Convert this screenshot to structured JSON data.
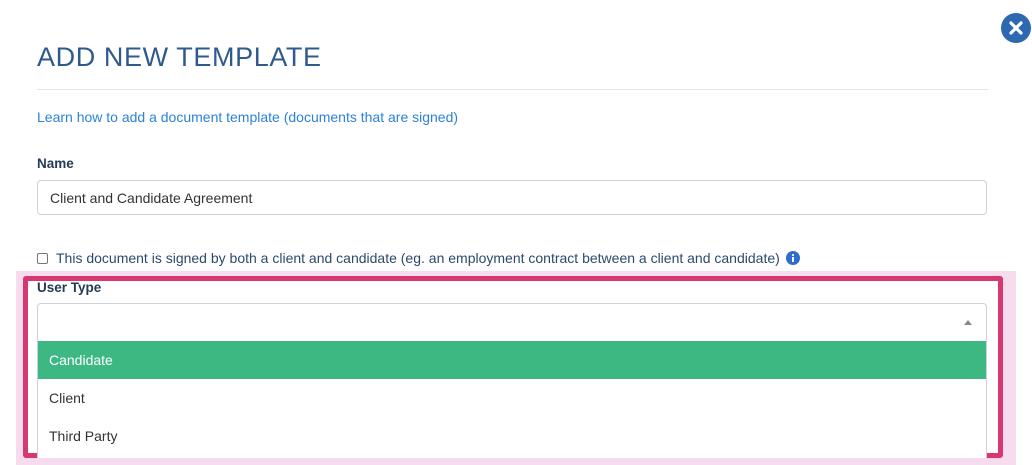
{
  "modal": {
    "title": "ADD NEW TEMPLATE",
    "close_icon": "close-icon",
    "help_link": "Learn how to add a document template (documents that are signed)"
  },
  "form": {
    "name": {
      "label": "Name",
      "value": "Client and Candidate Agreement"
    },
    "both_signers": {
      "checked": false,
      "label": "This document is signed by both a client and candidate (eg. an employment contract between a client and candidate)",
      "info_icon": "info-icon"
    },
    "user_type": {
      "label": "User Type",
      "selected_value": "",
      "options": [
        "Candidate",
        "Client",
        "Third Party"
      ],
      "highlighted_option": "Candidate"
    }
  },
  "colors": {
    "title": "#2f5a8e",
    "link": "#2c82d8",
    "close_button": "#2e68b1",
    "highlight_border": "#d8376f",
    "option_highlight": "#3eb883"
  }
}
